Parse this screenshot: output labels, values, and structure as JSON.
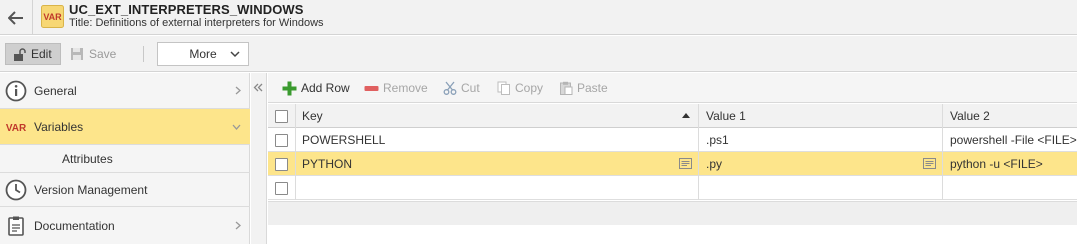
{
  "header": {
    "object_name": "UC_EXT_INTERPRETERS_WINDOWS",
    "object_title": "Title: Definitions of external interpreters for Windows",
    "type_icon_text": "VAR"
  },
  "toolbar": {
    "edit_label": "Edit",
    "save_label": "Save",
    "more_label": "More"
  },
  "sidebar": {
    "items": [
      {
        "label": "General",
        "icon": "info-circle-icon"
      },
      {
        "label": "Variables",
        "icon": "var-icon",
        "icon_text": "VAR",
        "active": true
      },
      {
        "label": "Attributes",
        "sub": true
      },
      {
        "label": "Version Management",
        "icon": "clock-icon"
      },
      {
        "label": "Documentation",
        "icon": "clipboard-icon"
      }
    ]
  },
  "grid_toolbar": {
    "add_row": "Add Row",
    "remove": "Remove",
    "cut": "Cut",
    "copy": "Copy",
    "paste": "Paste"
  },
  "grid": {
    "columns": [
      "Key",
      "Value 1",
      "Value 2"
    ],
    "rows": [
      {
        "key": "POWERSHELL",
        "value1": ".ps1",
        "value2": "powershell -File <FILE>"
      },
      {
        "key": "PYTHON",
        "value1": ".py",
        "value2": "python -u <FILE>",
        "selected": true
      },
      {
        "key": "",
        "value1": "",
        "value2": ""
      }
    ]
  },
  "colors": {
    "selection": "#fde58b",
    "var_icon_text": "#c0392b",
    "add_green": "#3a9a2f",
    "remove_red": "#e06060"
  }
}
